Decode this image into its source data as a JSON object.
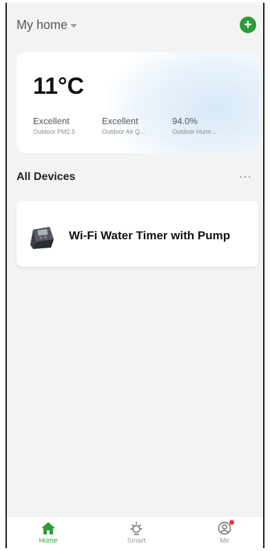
{
  "header": {
    "home_label": "My home",
    "add_icon": "plus-icon"
  },
  "weather": {
    "temperature": "11°C",
    "metrics": [
      {
        "value": "Excellent",
        "label": "Outdoor PM2.5"
      },
      {
        "value": "Excellent",
        "label": "Outdoor Air Q..."
      },
      {
        "value": "94.0%",
        "label": "Outdoor Humi..."
      }
    ]
  },
  "devices": {
    "title": "All Devices",
    "more_label": "···",
    "items": [
      {
        "name": "Wi-Fi Water Timer with Pump",
        "icon": "water-timer-device"
      }
    ]
  },
  "tabbar": {
    "tabs": [
      {
        "label": "Home",
        "icon": "home-icon",
        "active": true
      },
      {
        "label": "Smart",
        "icon": "sun-icon",
        "active": false
      },
      {
        "label": "Me",
        "icon": "user-icon",
        "active": false
      }
    ]
  },
  "colors": {
    "accent": "#2d9b3a",
    "badge": "#e53935",
    "background": "#f3f3f3"
  }
}
